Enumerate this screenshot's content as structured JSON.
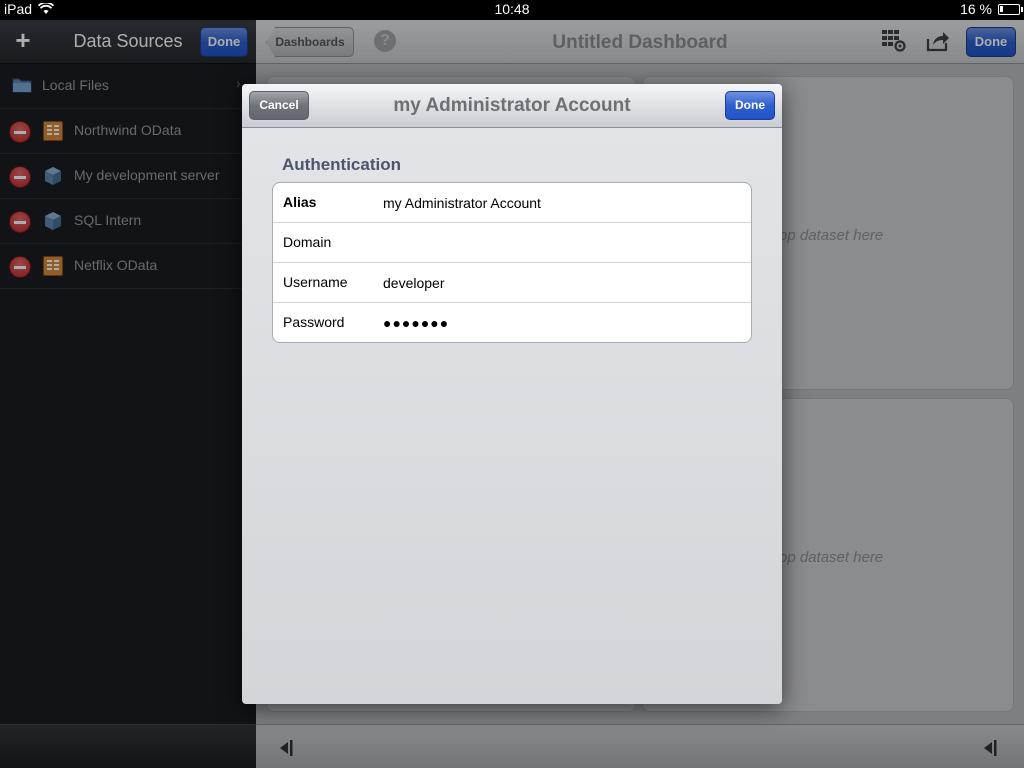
{
  "status_bar": {
    "device": "iPad",
    "time": "10:48",
    "battery": "16 %"
  },
  "data_sources_panel": {
    "add_label": "+",
    "title": "Data Sources",
    "done_label": "Done",
    "local_files": "Local Files",
    "items": [
      {
        "label": "Northwind OData",
        "icon": "odata-icon"
      },
      {
        "label": "My development server",
        "icon": "server-cube-icon"
      },
      {
        "label": "SQL Intern",
        "icon": "server-cube-icon"
      },
      {
        "label": "Netflix OData",
        "icon": "odata-icon"
      }
    ]
  },
  "dashboard": {
    "back_label": "Dashboards",
    "help_label": "?",
    "title": "Untitled Dashboard",
    "done_label": "Done",
    "drop_hint": "op dataset here"
  },
  "modal": {
    "cancel_label": "Cancel",
    "title": "my Administrator Account",
    "done_label": "Done",
    "section_header": "Authentication",
    "fields": {
      "alias": {
        "label": "Alias",
        "value": "my Administrator Account"
      },
      "domain": {
        "label": "Domain",
        "value": ""
      },
      "username": {
        "label": "Username",
        "value": "developer"
      },
      "password": {
        "label": "Password",
        "value": "●●●●●●●"
      }
    }
  },
  "colors": {
    "accent_blue": "#2f5fcf",
    "delete_red": "#b8262a",
    "sidebar_bg": "#1b1c21"
  }
}
